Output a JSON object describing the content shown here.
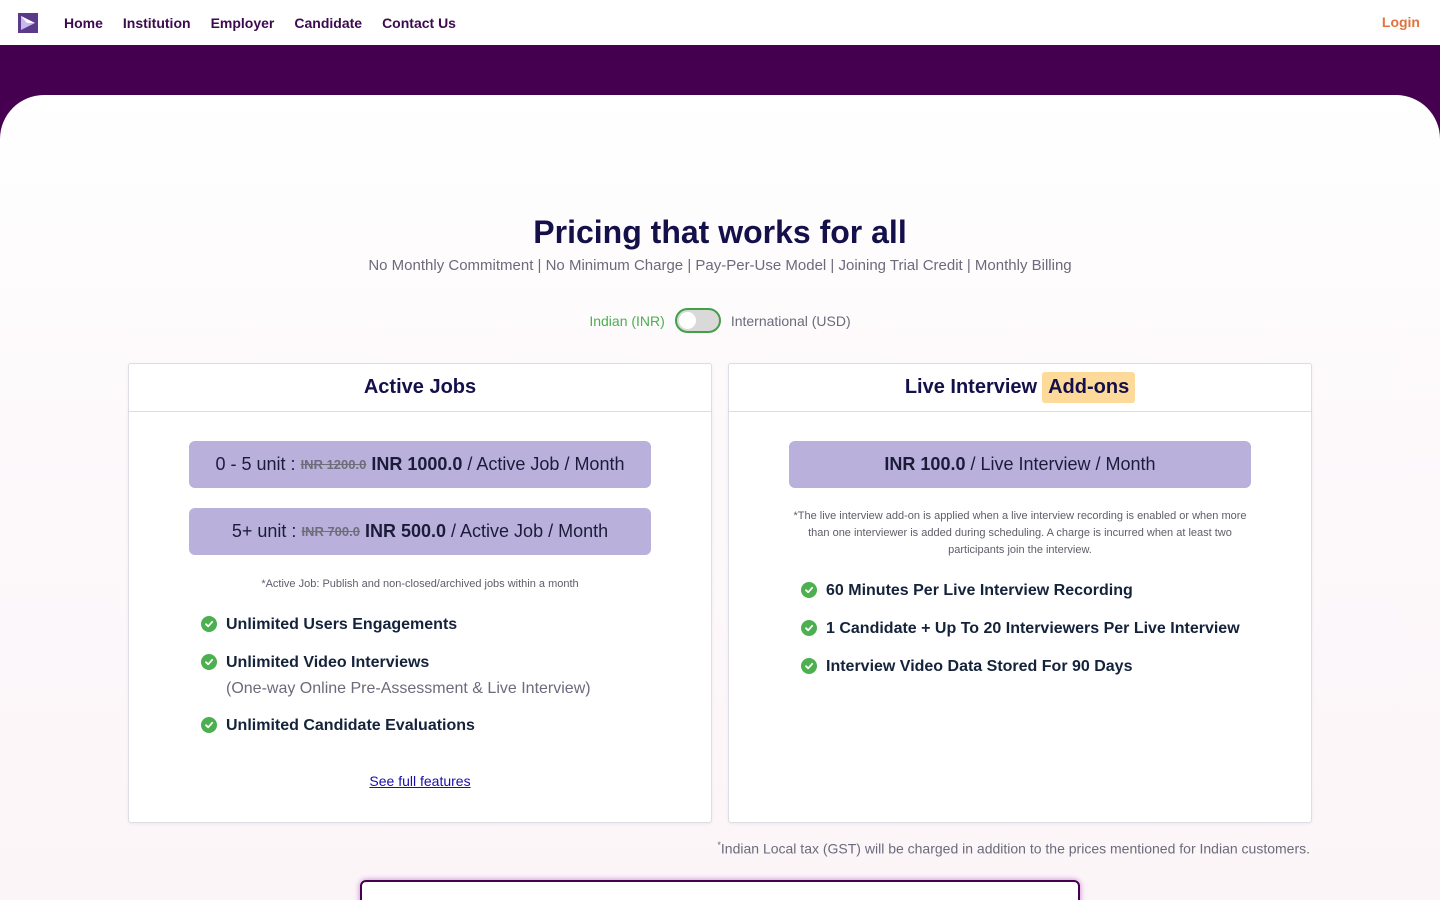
{
  "nav": {
    "links": [
      "Home",
      "Institution",
      "Employer",
      "Candidate",
      "Contact Us"
    ],
    "login": "Login",
    "logo_icon": "play-logo-icon"
  },
  "hero": {
    "title": "Pricing that works for all",
    "subtitle": "No Monthly Commitment | No Minimum Charge | Pay-Per-Use Model | Joining Trial Credit | Monthly Billing"
  },
  "currency": {
    "left": "Indian (INR)",
    "right": "International (USD)",
    "toggle_state": "off"
  },
  "active_jobs": {
    "title": "Active Jobs",
    "tiers": [
      {
        "range": "0 - 5 unit :",
        "old_price": "INR 1200.0",
        "price": "INR 1000.0",
        "unit": "/ Active Job / Month"
      },
      {
        "range": "5+ unit :",
        "old_price": "INR 700.0",
        "price": "INR 500.0",
        "unit": "/ Active Job / Month"
      }
    ],
    "note": "*Active Job: Publish and non-closed/archived jobs within a month",
    "features": [
      {
        "text": "Unlimited Users Engagements",
        "sub": ""
      },
      {
        "text": "Unlimited Video Interviews",
        "sub": "(One-way Online Pre-Assessment & Live Interview)"
      },
      {
        "text": "Unlimited Candidate Evaluations",
        "sub": ""
      }
    ],
    "link": "See full features"
  },
  "live_interview": {
    "title": "Live Interview",
    "badge": "Add-ons",
    "price": "INR 100.0",
    "unit": "/ Live Interview / Month",
    "note": "*The live interview add-on is applied when a live interview recording is enabled or when more than one interviewer is added during scheduling. A charge is incurred when at least two participants join the interview.",
    "features": [
      "60 Minutes Per Live Interview Recording",
      "1 Candidate + Up To 20 Interviewers Per Live Interview",
      "Interview Video Data Stored For 90 Days"
    ]
  },
  "gst_note": {
    "marker": "*",
    "text": "Indian Local tax (GST) will be charged in addition to the prices mentioned for Indian customers."
  },
  "colors": {
    "brand_purple": "#45004f",
    "pill": "#b9b1dc",
    "check": "#4caf50",
    "login": "#e2733e",
    "addon_badge": "#fdd99a"
  }
}
